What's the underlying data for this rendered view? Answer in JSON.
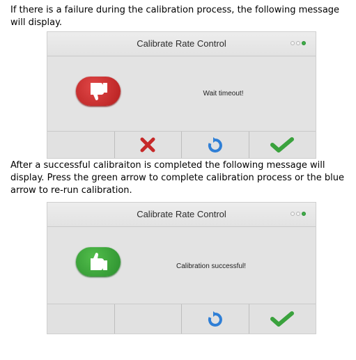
{
  "instructions": {
    "failure_text": "If there is a failure during the calibration process, the following message will display.",
    "success_text": "After a successful calibraiton is completed the following message will display. Press the green arrow to complete calibration process or the blue arrow to re-run calibration."
  },
  "failure_dialog": {
    "title": "Calibrate Rate Control",
    "message": "Wait timeout!",
    "status_icon": "thumbs-down-icon",
    "buttons": [
      "blank",
      "close-icon",
      "refresh-icon",
      "checkmark-icon"
    ]
  },
  "success_dialog": {
    "title": "Calibrate Rate Control",
    "message": "Calibration successful!",
    "status_icon": "thumbs-up-icon",
    "buttons": [
      "blank",
      "blank",
      "refresh-icon",
      "checkmark-icon"
    ]
  },
  "colors": {
    "fail_red": "#c62828",
    "success_green": "#3aa23d",
    "refresh_blue": "#2f7fd6",
    "panel_gray": "#e3e3e3"
  }
}
